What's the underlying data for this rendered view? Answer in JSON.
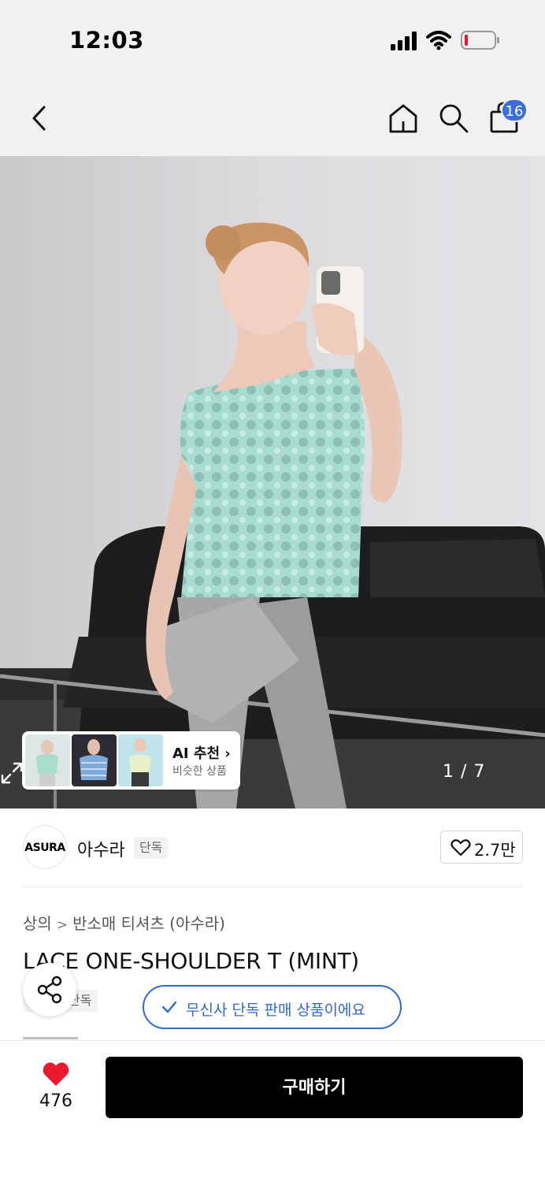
{
  "status_bar": {
    "time": "12:03"
  },
  "nav": {
    "cart_badge": "16"
  },
  "gallery": {
    "ai_title": "AI 추천 ›",
    "ai_subtitle": "비슷한 상품",
    "page_counter": "1 / 7"
  },
  "brand": {
    "logo_text": "ASURA",
    "name": "아수라",
    "exclusive_tag": "단독",
    "like_count": "2.7만"
  },
  "breadcrumb": {
    "level1": "상의",
    "level2": "반소매 티셔츠 (아수라)"
  },
  "product": {
    "title": "LACE ONE-SHOULDER T (MINT)",
    "tag": "단독",
    "exclusive_banner": "무신사 단독 판매 상품이에요"
  },
  "bottom_bar": {
    "heart_count": "476",
    "buy_label": "구매하기"
  },
  "colors": {
    "accent_blue": "#2f67d6",
    "badge_blue": "#3a6fd9",
    "heart_red": "#e8192c",
    "buy_black": "#000000"
  }
}
